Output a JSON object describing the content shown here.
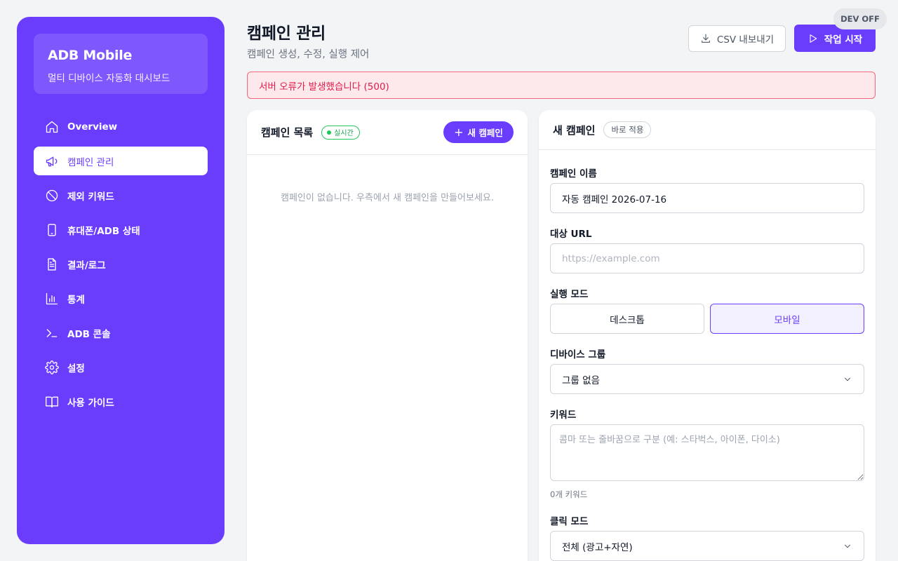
{
  "sidebar": {
    "brand_title": "ADB Mobile",
    "brand_subtitle": "멀티 디바이스 자동화 대시보드",
    "items": [
      {
        "label": "Overview",
        "icon": "home-icon"
      },
      {
        "label": "캠페인 관리",
        "icon": "megaphone-icon",
        "active": true
      },
      {
        "label": "제외 키워드",
        "icon": "ban-icon"
      },
      {
        "label": "휴대폰/ADB 상태",
        "icon": "phone-icon"
      },
      {
        "label": "결과/로그",
        "icon": "document-icon"
      },
      {
        "label": "통계",
        "icon": "bar-chart-icon"
      },
      {
        "label": "ADB 콘솔",
        "icon": "terminal-icon"
      },
      {
        "label": "설정",
        "icon": "gear-icon"
      },
      {
        "label": "사용 가이드",
        "icon": "book-icon"
      }
    ]
  },
  "header": {
    "title": "캠페인 관리",
    "subtitle": "캠페인 생성, 수정, 실행 제어",
    "csv_button": "CSV 내보내기",
    "start_button": "작업 시작",
    "dev_badge": "DEV OFF"
  },
  "error_banner": "서버 오류가 발생했습니다 (500)",
  "campaign_list": {
    "title": "캠페인 목록",
    "live_badge": "실시간",
    "new_button": "새 캠페인",
    "empty_message": "캠페인이 없습니다. 우측에서 새 캠페인을 만들어보세요."
  },
  "form": {
    "title": "새 캠페인",
    "apply_badge": "바로 적용",
    "name_label": "캠페인 이름",
    "name_value": "자동 캠페인 2026-07-16",
    "url_label": "대상 URL",
    "url_placeholder": "https://example.com",
    "mode_label": "실행 모드",
    "mode_desktop": "데스크톱",
    "mode_mobile": "모바일",
    "mode_selected": "모바일",
    "device_group_label": "디바이스 그룹",
    "device_group_value": "그룹 없음",
    "keyword_label": "키워드",
    "keyword_placeholder": "콤마 또는 줄바꿈으로 구분 (예: 스타벅스, 아이폰, 다이소)",
    "keyword_count": "0개 키워드",
    "click_mode_label": "클릭 모드",
    "click_mode_value": "전체 (광고+자연)"
  },
  "colors": {
    "accent": "#6a3dfd",
    "error": "#e11d48",
    "live": "#22c55e"
  }
}
